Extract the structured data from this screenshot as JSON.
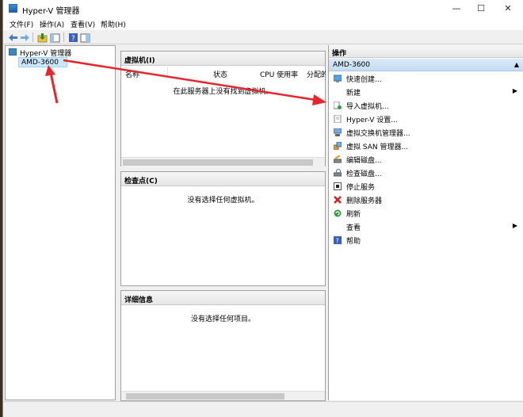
{
  "window": {
    "title": "Hyper-V 管理器",
    "controls": {
      "minimize": "—",
      "maximize": "☐",
      "close": "✕"
    }
  },
  "menu": [
    "文件(F)",
    "操作(A)",
    "查看(V)",
    "帮助(H)"
  ],
  "tree": {
    "root": "Hyper-V 管理器",
    "server": "AMD-3600"
  },
  "vm_panel": {
    "title": "虚拟机(I)",
    "columns": [
      "名称",
      "状态",
      "CPU 使用率",
      "分配的"
    ],
    "empty": "在此服务器上没有找到虚拟机。"
  },
  "checkpoint_panel": {
    "title": "检查点(C)",
    "empty": "没有选择任何虚拟机。"
  },
  "details_panel": {
    "title": "详细信息",
    "empty": "没有选择任何项目。"
  },
  "actions": {
    "title": "操作",
    "group": "AMD-3600",
    "items": [
      {
        "label": "快速创建...",
        "icon": "quick-create-icon"
      },
      {
        "label": "新建",
        "icon": "none",
        "submenu": "▶"
      },
      {
        "label": "导入虚拟机...",
        "icon": "import-vm-icon"
      },
      {
        "label": "Hyper-V 设置...",
        "icon": "settings-doc-icon"
      },
      {
        "label": "虚拟交换机管理器...",
        "icon": "virtual-switch-icon"
      },
      {
        "label": "虚拟 SAN 管理器...",
        "icon": "san-icon"
      },
      {
        "label": "编辑磁盘...",
        "icon": "edit-disk-icon"
      },
      {
        "label": "检查磁盘...",
        "icon": "inspect-disk-icon"
      },
      {
        "label": "停止服务",
        "icon": "stop-icon"
      },
      {
        "label": "删除服务器",
        "icon": "delete-red-x-icon"
      },
      {
        "label": "刷新",
        "icon": "refresh-icon"
      },
      {
        "label": "查看",
        "icon": "none",
        "submenu": "▶"
      },
      {
        "label": "帮助",
        "icon": "help-icon"
      }
    ]
  },
  "colors": {
    "annotation_arrow": "#e8252b",
    "selection": "#cce8ff",
    "actions_group": "#c6dcf2"
  }
}
